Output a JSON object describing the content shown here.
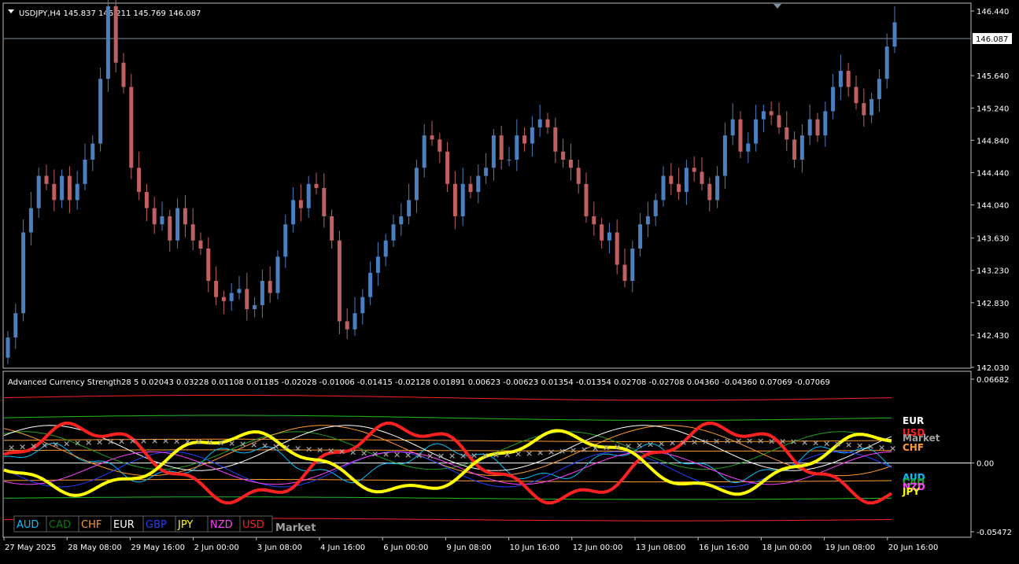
{
  "main_chart": {
    "title": "USDJPY,H4  145.837 146.211 145.769 146.087",
    "current_price_label": "146.087",
    "price_axis": [
      "146.440",
      "145.640",
      "145.240",
      "144.840",
      "144.440",
      "144.040",
      "143.630",
      "143.230",
      "142.830",
      "142.430",
      "142.030"
    ],
    "price_min": 142.03,
    "price_max": 146.44,
    "current_price": 146.087
  },
  "indicator": {
    "title": "Advanced Currency Strength28 5 0.02043 0.03228 0.01108 0.01185 -0.02028 -0.01006 -0.01415 -0.02128 0.01891 0.00623 -0.00623 0.01354 -0.01354 0.02708 -0.02708 0.04360 -0.04360 0.07069 -0.07069",
    "axis": [
      "0.06682",
      "0.00",
      "-0.05472"
    ],
    "right_labels": [
      {
        "text": "EUR",
        "color": "#ffffff"
      },
      {
        "text": "USD",
        "color": "#ff2020"
      },
      {
        "text": "Market",
        "color": "#a0a0a0"
      },
      {
        "text": "CHF",
        "color": "#ff9a30"
      },
      {
        "text": "AUD",
        "color": "#00c0ff"
      },
      {
        "text": "CAD",
        "color": "#20a020"
      },
      {
        "text": "NZD",
        "color": "#ff40ff"
      },
      {
        "text": "JPY",
        "color": "#ffff00"
      }
    ],
    "legend": [
      {
        "text": "AUD",
        "color": "#00c0ff"
      },
      {
        "text": "CAD",
        "color": "#0a7a0a"
      },
      {
        "text": "CHF",
        "color": "#ff9a30"
      },
      {
        "text": "EUR",
        "color": "#ffffff"
      },
      {
        "text": "GBP",
        "color": "#2040ff"
      },
      {
        "text": "JPY",
        "color": "#ffff00"
      },
      {
        "text": "NZD",
        "color": "#ff40ff"
      },
      {
        "text": "USD",
        "color": "#ff2020"
      }
    ],
    "market_label": "Market"
  },
  "time_axis": [
    "27 May 2025",
    "28 May 08:00",
    "29 May 16:00",
    "2 Jun 00:00",
    "3 Jun 08:00",
    "4 Jun 16:00",
    "6 Jun 00:00",
    "9 Jun 08:00",
    "10 Jun 16:00",
    "12 Jun 00:00",
    "13 Jun 08:00",
    "16 Jun 16:00",
    "18 Jun 00:00",
    "19 Jun 08:00",
    "20 Jun 16:00"
  ],
  "colors": {
    "bull": "#4a7fc0",
    "bear": "#c06060",
    "grid": "#ffffff",
    "priceline": "#8090a0"
  },
  "chart_data": {
    "type": "candlestick",
    "symbol": "USDJPY",
    "timeframe": "H4",
    "ylim": [
      142.03,
      146.44
    ],
    "closes": [
      142.4,
      142.7,
      143.7,
      144.0,
      144.4,
      144.3,
      144.1,
      144.4,
      144.1,
      144.3,
      144.6,
      144.8,
      145.6,
      146.5,
      145.8,
      145.5,
      144.5,
      144.2,
      144.0,
      143.8,
      143.9,
      143.6,
      144.0,
      143.8,
      143.6,
      143.5,
      143.1,
      142.9,
      142.85,
      142.95,
      143.0,
      142.75,
      142.8,
      143.1,
      142.95,
      143.4,
      143.8,
      144.1,
      144.0,
      144.3,
      144.25,
      143.9,
      143.6,
      142.6,
      142.5,
      142.7,
      142.9,
      143.2,
      143.4,
      143.6,
      143.8,
      143.9,
      144.1,
      144.5,
      144.9,
      144.85,
      144.7,
      144.3,
      143.9,
      144.3,
      144.2,
      144.4,
      144.5,
      144.9,
      144.6,
      144.6,
      144.9,
      144.8,
      145.0,
      145.1,
      145.0,
      144.7,
      144.6,
      144.5,
      144.3,
      143.9,
      143.8,
      143.6,
      143.7,
      143.3,
      143.1,
      143.5,
      143.8,
      143.9,
      144.1,
      144.4,
      144.3,
      144.2,
      144.5,
      144.45,
      144.3,
      144.1,
      144.4,
      144.9,
      145.1,
      144.7,
      144.8,
      145.1,
      145.2,
      145.15,
      145.0,
      144.85,
      144.6,
      144.9,
      145.1,
      144.9,
      145.2,
      145.5,
      145.7,
      145.5,
      145.3,
      145.15,
      145.35,
      145.6,
      146.0,
      146.3
    ]
  }
}
